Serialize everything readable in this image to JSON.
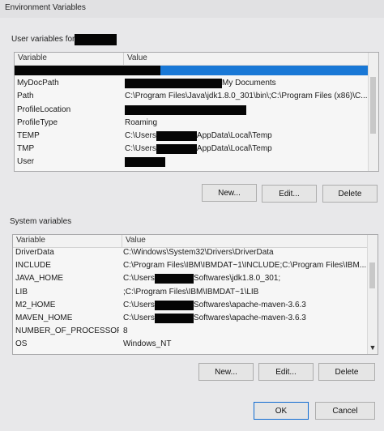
{
  "window": {
    "title": "Environment Variables"
  },
  "user_section": {
    "label": "User variables for"
  },
  "system_section": {
    "label": "System variables"
  },
  "columns": {
    "variable": "Variable",
    "value": "Value"
  },
  "user_rows": [
    {
      "name": "",
      "value": []
    },
    {
      "name": "MyDocPath",
      "value": [
        {
          "t": "",
          "b": 1
        },
        {
          "t": "My Documents"
        }
      ]
    },
    {
      "name": "Path",
      "value": [
        {
          "t": "C:\\Program Files\\Java\\jdk1.8.0_301\\bin\\;C:\\Program Files (x86)\\C..."
        }
      ]
    },
    {
      "name": "ProfileLocation",
      "value": [
        {
          "t": "",
          "b": 1
        }
      ]
    },
    {
      "name": "ProfileType",
      "value": [
        {
          "t": "Roaming"
        }
      ]
    },
    {
      "name": "TEMP",
      "value": [
        {
          "t": "C:\\Users"
        },
        {
          "t": "",
          "b": 1
        },
        {
          "t": "AppData\\Local\\Temp"
        }
      ]
    },
    {
      "name": "TMP",
      "value": [
        {
          "t": "C:\\Users"
        },
        {
          "t": "",
          "b": 1
        },
        {
          "t": "AppData\\Local\\Temp"
        }
      ]
    },
    {
      "name": "User",
      "value": [
        {
          "t": "",
          "b": 1
        }
      ]
    }
  ],
  "system_rows": [
    {
      "name": "DriverData",
      "value": [
        {
          "t": "C:\\Windows\\System32\\Drivers\\DriverData"
        }
      ]
    },
    {
      "name": "INCLUDE",
      "value": [
        {
          "t": "C:\\Program Files\\IBM\\IBMDAT~1\\INCLUDE;C:\\Program Files\\IBM..."
        }
      ]
    },
    {
      "name": "JAVA_HOME",
      "value": [
        {
          "t": "C:\\Users"
        },
        {
          "t": "",
          "b": 1
        },
        {
          "t": "Softwares\\jdk1.8.0_301;"
        }
      ]
    },
    {
      "name": "LIB",
      "value": [
        {
          "t": ";C:\\Program Files\\IBM\\IBMDAT~1\\LIB"
        }
      ]
    },
    {
      "name": "M2_HOME",
      "value": [
        {
          "t": "C:\\Users"
        },
        {
          "t": "",
          "b": 1
        },
        {
          "t": "Softwares\\apache-maven-3.6.3"
        }
      ]
    },
    {
      "name": "MAVEN_HOME",
      "value": [
        {
          "t": "C:\\Users"
        },
        {
          "t": "",
          "b": 1
        },
        {
          "t": "Softwares\\apache-maven-3.6.3"
        }
      ]
    },
    {
      "name": "NUMBER_OF_PROCESSORS",
      "value": [
        {
          "t": "8"
        }
      ]
    },
    {
      "name": "OS",
      "value": [
        {
          "t": "Windows_NT"
        }
      ]
    }
  ],
  "user_buttons": {
    "new": "New...",
    "edit": "Edit...",
    "delete": "Delete"
  },
  "system_buttons": {
    "new": "New...",
    "edit": "Edit...",
    "delete": "Delete"
  },
  "dialog_buttons": {
    "ok": "OK",
    "cancel": "Cancel"
  },
  "icons": {
    "scroll_up": "up-arrow-icon",
    "scroll_down": "down-arrow-icon"
  },
  "colors": {
    "selection": "#1978d6",
    "default_button_border": "#0f6bd0"
  }
}
